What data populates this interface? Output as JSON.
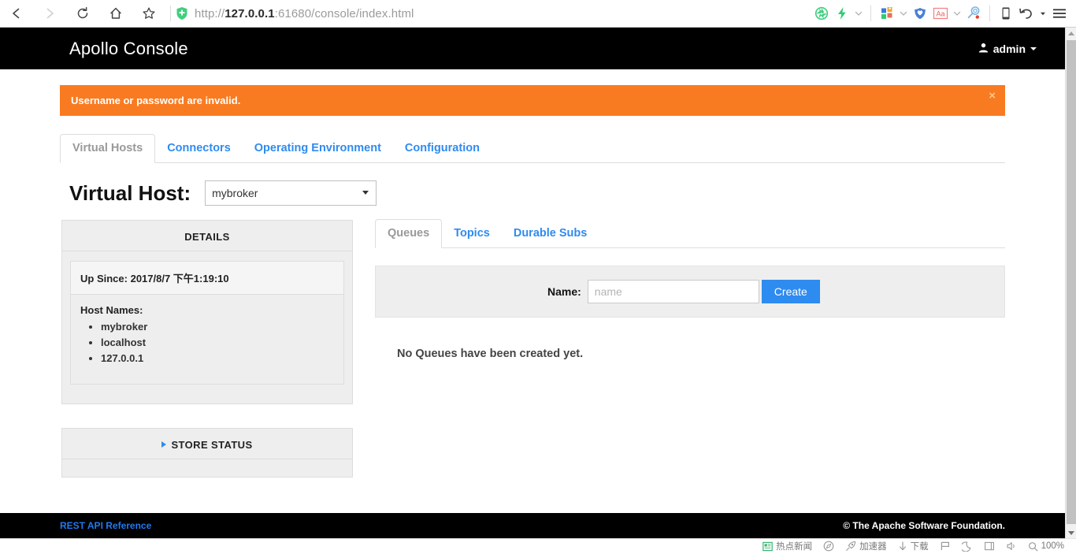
{
  "browser": {
    "back_icon": "back-arrow-icon",
    "forward_icon": "forward-arrow-icon",
    "reload_icon": "reload-icon",
    "home_icon": "home-icon",
    "bookmark_icon": "star-icon",
    "security_icon": "shield-plus-icon",
    "url_protocol": "http://",
    "url_host": "127.0.0.1",
    "url_rest": ":61680/console/index.html",
    "right_icons": [
      {
        "name": "shutter-icon",
        "label": "screenshot"
      },
      {
        "name": "lightning-icon",
        "label": "speed"
      },
      {
        "name": "chevron-down-icon",
        "label": "more"
      },
      {
        "name": "extensions-grid-icon",
        "label": "extensions"
      },
      {
        "name": "chevron-down-icon-2",
        "label": "more extensions"
      },
      {
        "name": "shield-heart-icon",
        "label": "security"
      },
      {
        "name": "translate-aa-icon",
        "label": "translate"
      },
      {
        "name": "chevron-down-icon-3",
        "label": "more tools"
      },
      {
        "name": "search-magnifier-icon",
        "label": "search"
      },
      {
        "name": "mobile-device-icon",
        "label": "mobile view"
      },
      {
        "name": "undo-icon",
        "label": "undo"
      },
      {
        "name": "caret-small-icon",
        "label": "undo options"
      },
      {
        "name": "hamburger-menu-icon",
        "label": "menu"
      }
    ]
  },
  "app": {
    "brand": "Apollo Console",
    "user": "admin"
  },
  "alert": {
    "message": "Username or password are invalid.",
    "close_label": "×"
  },
  "nav_tabs": [
    {
      "label": "Virtual Hosts",
      "active": true
    },
    {
      "label": "Connectors",
      "active": false
    },
    {
      "label": "Operating Environment",
      "active": false
    },
    {
      "label": "Configuration",
      "active": false
    }
  ],
  "vhost": {
    "label": "Virtual Host:",
    "selected": "mybroker",
    "options": [
      "mybroker"
    ]
  },
  "details_panel": {
    "title": "DETAILS",
    "up_since_label": "Up Since:",
    "up_since_value": "2017/8/7 下午1:19:10",
    "host_names_label": "Host Names:",
    "host_names": [
      "mybroker",
      "localhost",
      "127.0.0.1"
    ]
  },
  "store_panel": {
    "title": "STORE STATUS",
    "expanded": false
  },
  "sub_tabs": [
    {
      "label": "Queues",
      "active": true
    },
    {
      "label": "Topics",
      "active": false
    },
    {
      "label": "Durable Subs",
      "active": false
    }
  ],
  "create_form": {
    "name_label": "Name:",
    "name_value": "",
    "name_placeholder": "name",
    "create_button": "Create"
  },
  "empty_state": "No Queues have been created yet.",
  "footer": {
    "link": "REST API Reference",
    "copyright": "© The Apache Software Foundation."
  },
  "taskbar": {
    "items": [
      {
        "icon": "news-icon",
        "label": "热点新闻"
      },
      {
        "icon": "compass-icon",
        "label": ""
      },
      {
        "icon": "rocket-icon",
        "label": "加速器"
      },
      {
        "icon": "download-arrow-icon",
        "label": "下载"
      },
      {
        "icon": "flag-icon",
        "label": ""
      },
      {
        "icon": "moon-icon",
        "label": ""
      },
      {
        "icon": "window-icon",
        "label": ""
      },
      {
        "icon": "speaker-icon",
        "label": ""
      },
      {
        "icon": "zoom-magnifier-icon",
        "label": "100%"
      }
    ]
  },
  "colors": {
    "accent_blue": "#2e8bf0",
    "alert_orange": "#f97b21",
    "header_black": "#000000"
  }
}
